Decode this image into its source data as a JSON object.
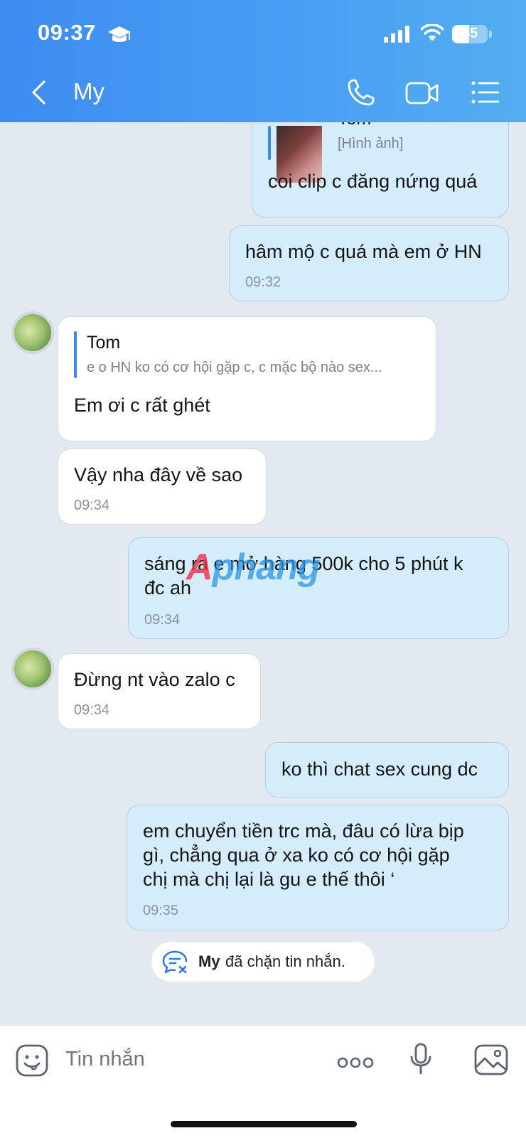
{
  "status_bar": {
    "time": "09:37",
    "battery": "45"
  },
  "header": {
    "title": "My"
  },
  "messages": [
    {
      "direction": "out",
      "quote_name": "Tom",
      "quote_text": "[Hình ảnh]",
      "text": "coi clip c đăng nứng quá"
    },
    {
      "direction": "out",
      "text": "hâm mộ c quá mà em ở HN",
      "time": "09:32"
    },
    {
      "direction": "in",
      "quote_name": "Tom",
      "quote_text": "e o HN ko có cơ hội gặp c, c mặc bộ nào sex...",
      "text": "Em ơi c rất ghét"
    },
    {
      "direction": "in",
      "text": "Vậy nha đây về sao",
      "time": "09:34"
    },
    {
      "direction": "out",
      "text_lines": [
        "sáng ra e mở hàng 500k cho 5 phút k",
        "đc ah"
      ],
      "time": "09:34"
    },
    {
      "direction": "in",
      "text": "Đừng nt vào zalo c",
      "time": "09:34"
    },
    {
      "direction": "out",
      "text": "ko thì chat sex cung dc"
    },
    {
      "direction": "out",
      "text_lines": [
        "em chuyển tiền trc mà, đâu có lừa bịp",
        "gì, chẳng qua ở xa ko có cơ hội gặp",
        "chị mà chị lại là gu e thế thôi ‘"
      ],
      "time": "09:35"
    }
  ],
  "system_notice": {
    "name": "My",
    "text": "đã chặn tin nhắn."
  },
  "watermark": {
    "text_a": "A",
    "text_b": "phang"
  },
  "composer": {
    "placeholder": "Tin nhắn"
  }
}
